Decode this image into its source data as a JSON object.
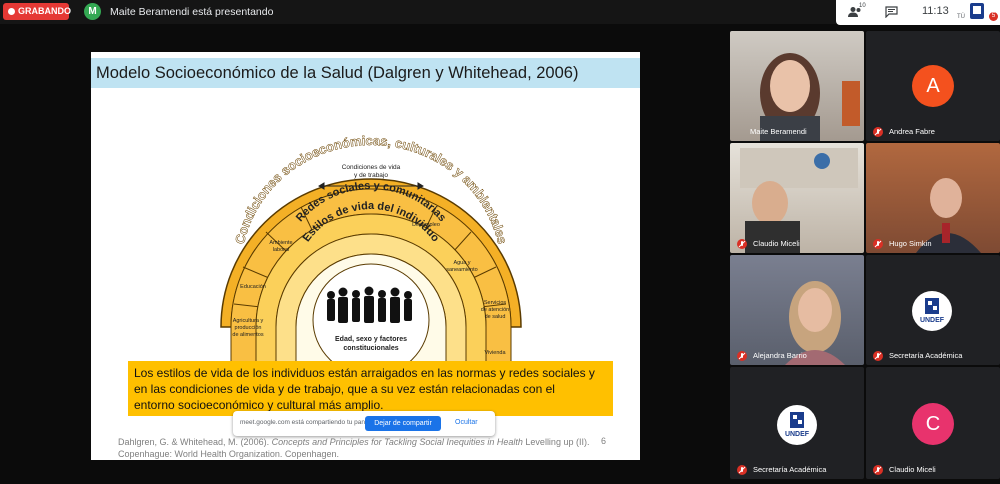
{
  "top_bar": {
    "recording_label": "GRABANDO",
    "presenter_initial": "M",
    "presenter_text": "Maite Beramendi está presentando"
  },
  "system_bar": {
    "participants_count": "10",
    "time": "11:13",
    "self_label": "TÚ",
    "notification_count": "5"
  },
  "slide": {
    "title": "Modelo Socioeconómico de la Salud (Dalgren y Whitehead, 2006)",
    "diagram": {
      "outer_arc": "Condiciones socioeconómicas, culturales y ambientales",
      "middle_arc": "Redes sociales y comunitarias",
      "inner_arc": "Estilos de vida del individuo",
      "core": [
        "Edad, sexo y factores",
        "constitucionales"
      ],
      "living_conditions": [
        "Condiciones de vida",
        "y de trabajo"
      ],
      "segments": [
        [
          "Agricultura y",
          "producción",
          "de alimentos"
        ],
        [
          "Educación"
        ],
        [
          "Ambiente",
          "laboral"
        ],
        [
          "Desempleo"
        ],
        [
          "Agua y",
          "saneamiento"
        ],
        [
          "Servicios",
          "de atención",
          "de salud"
        ],
        [
          "Vivienda"
        ]
      ]
    },
    "highlight_text": [
      "Los estilos de vida de los individuos están arraigados en las normas y redes sociales y",
      "en las condiciones de vida y de trabajo, que a su vez están relacionadas con el",
      "entorno socioeconómico y cultural más amplio."
    ],
    "citation": {
      "authors": "Dahlgren, G. & Whitehead, M. (2006).",
      "work": "Concepts and Principles for Tackling Social Inequities in Health",
      "rest": "Levelling up (II).",
      "line2": "Copenhague: World Health Organization. Copenhagen."
    },
    "page_number": "6"
  },
  "share_notice": {
    "message": "meet.google.com está compartiendo tu pantalla.",
    "stop_label": "Dejar de compartir",
    "hide_label": "Ocultar"
  },
  "participants": [
    {
      "name": "Maite Beramendi"
    },
    {
      "name": "Andrea Fabre",
      "initial": "A",
      "color": "#f4511e"
    },
    {
      "name": "Claudio Miceli"
    },
    {
      "name": "Hugo Simkin"
    },
    {
      "name": "Alejandra Barrio"
    },
    {
      "name": "Secretaría Académica",
      "logo_text": "UNDEF"
    },
    {
      "name": "Secretaría Académica",
      "logo_text": "UNDEF"
    },
    {
      "name": "Claudio Miceli",
      "initial": "C",
      "color": "#e8336d"
    }
  ]
}
